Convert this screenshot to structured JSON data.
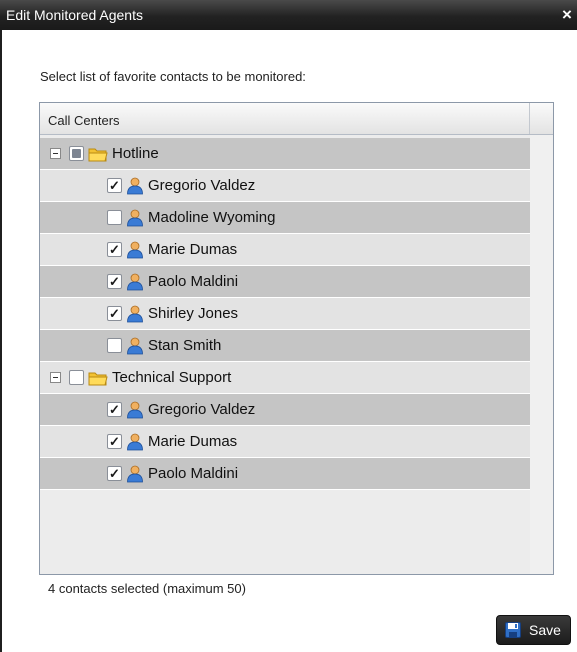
{
  "dialog": {
    "title": "Edit Monitored Agents",
    "close_glyph": "×",
    "instruction": "Select list of favorite contacts to be monitored:",
    "status": "4 contacts selected (maximum 50)",
    "save_label": "Save"
  },
  "tree": {
    "header": "Call Centers",
    "groups": [
      {
        "name": "Hotline",
        "state": "partial",
        "expanded": true,
        "agents": [
          {
            "name": "Gregorio Valdez",
            "checked": true
          },
          {
            "name": "Madoline Wyoming",
            "checked": false
          },
          {
            "name": "Marie Dumas",
            "checked": true
          },
          {
            "name": "Paolo Maldini",
            "checked": true
          },
          {
            "name": "Shirley Jones",
            "checked": true
          },
          {
            "name": "Stan Smith",
            "checked": false
          }
        ]
      },
      {
        "name": "Technical Support",
        "state": "unchecked",
        "expanded": true,
        "agents": [
          {
            "name": "Gregorio Valdez",
            "checked": true
          },
          {
            "name": "Marie Dumas",
            "checked": true
          },
          {
            "name": "Paolo Maldini",
            "checked": true
          }
        ]
      }
    ]
  },
  "icons": {
    "group": "folder-icon",
    "agent": "agent-icon",
    "collapse": "collapse-icon",
    "save": "floppy-disk-icon",
    "close": "close-icon"
  },
  "colors": {
    "titlebar": "#222222",
    "row_dark": "#c5c5c5",
    "row_light": "#e3e3e3",
    "save_icon": "#2f6fc6"
  }
}
